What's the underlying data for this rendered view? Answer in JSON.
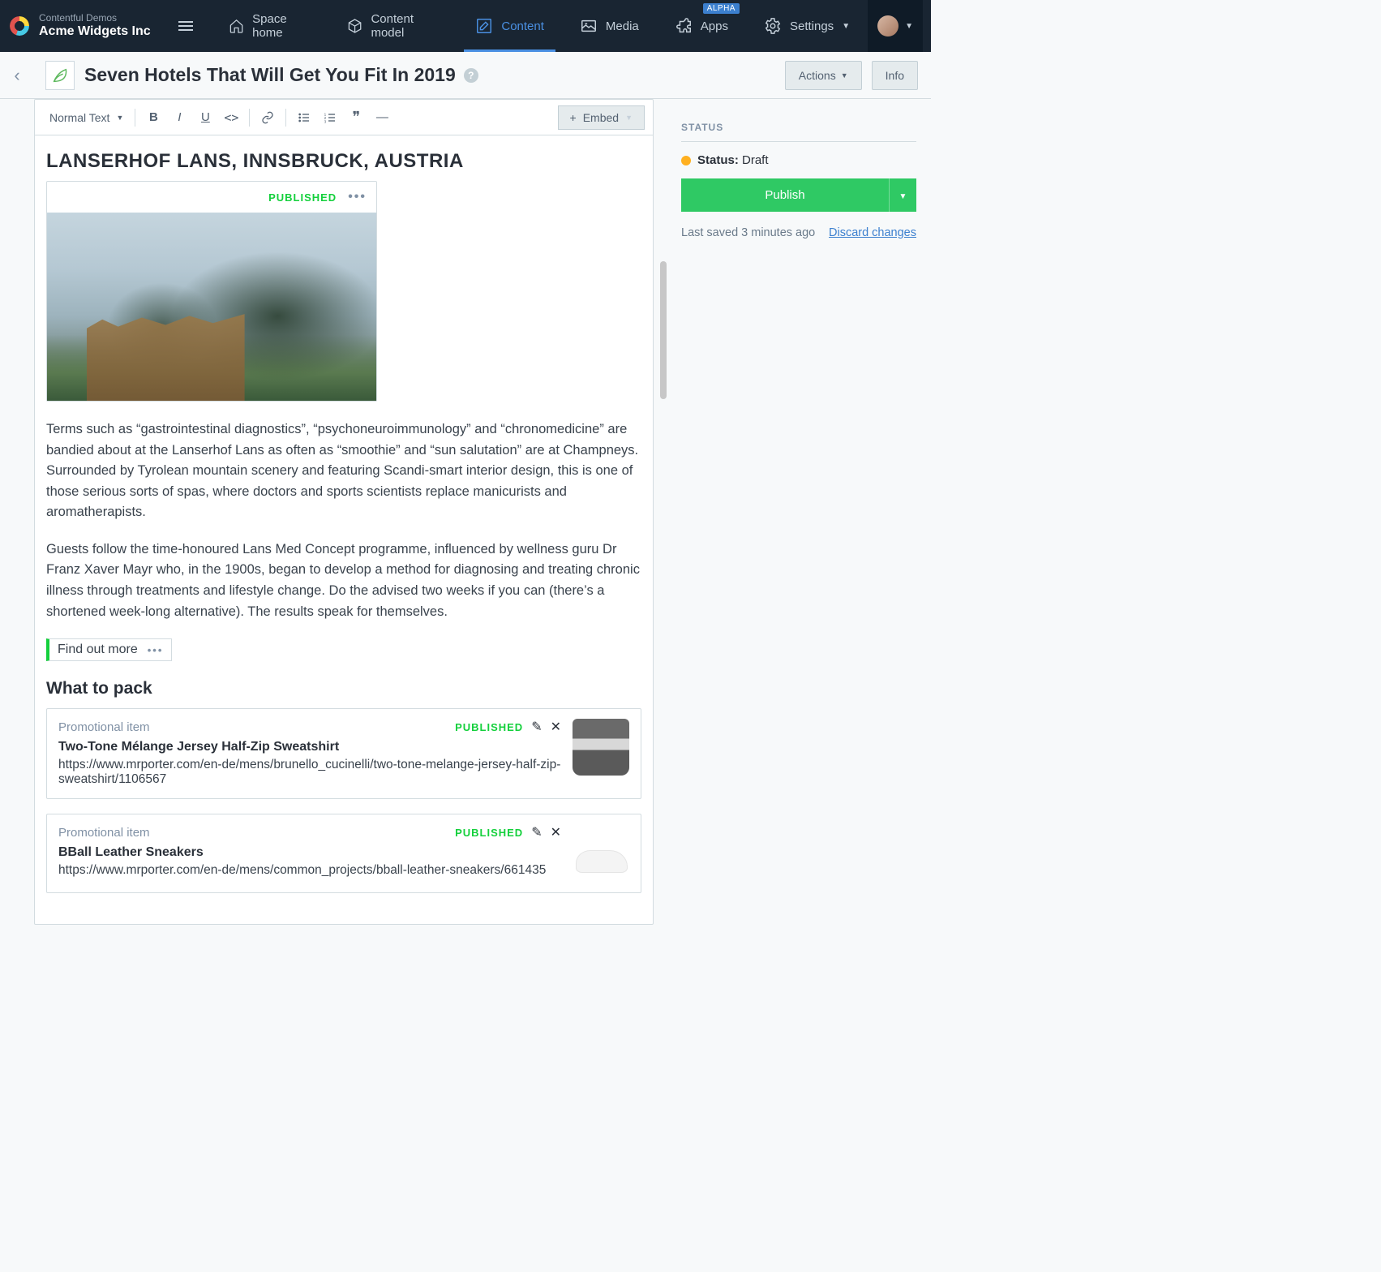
{
  "nav": {
    "org_top": "Contentful Demos",
    "org_bottom": "Acme Widgets Inc",
    "items": [
      {
        "label": "Space home",
        "icon": "home"
      },
      {
        "label": "Content model",
        "icon": "box"
      },
      {
        "label": "Content",
        "icon": "edit",
        "active": true
      },
      {
        "label": "Media",
        "icon": "media"
      },
      {
        "label": "Apps",
        "icon": "puzzle",
        "badge": "ALPHA"
      },
      {
        "label": "Settings",
        "icon": "gear",
        "caret": true
      }
    ]
  },
  "page": {
    "title": "Seven Hotels That Will Get You Fit In 2019",
    "actions_label": "Actions",
    "info_label": "Info"
  },
  "toolbar": {
    "text_style": "Normal Text",
    "embed_label": "Embed"
  },
  "content": {
    "heading": "LANSERHOF LANS, INNSBRUCK, AUSTRIA",
    "image_status": "PUBLISHED",
    "para1": "Terms such as “gastrointestinal diagnostics”, “psychoneuroimmunology” and “chronomedicine” are bandied about at the Lanserhof Lans as often as “smoothie” and “sun salutation” are at Champneys. Surrounded by Tyrolean mountain scenery and featuring Scandi-smart interior design, this is one of those serious sorts of spas, where doctors and sports scientists replace manicurists and aromatherapists.",
    "para2": "Guests follow the time-honoured Lans Med Concept programme, influenced by wellness guru Dr Franz Xaver Mayr who, in the 1900s, began to develop a method for diagnosing and treating chronic illness through treatments and lifestyle change. Do the advised two weeks if you can (there’s a shortened week-long alternative). The results speak for themselves.",
    "inline_entry": "Find out more",
    "subheading": "What to pack",
    "promos": [
      {
        "type": "Promotional item",
        "status": "PUBLISHED",
        "name": "Two-Tone Mélange Jersey Half-Zip Sweatshirt",
        "url": "https://www.mrporter.com/en-de/mens/brunello_cucinelli/two-tone-melange-jersey-half-zip-sweatshirt/1106567",
        "thumb": "sweat"
      },
      {
        "type": "Promotional item",
        "status": "PUBLISHED",
        "name": "BBall Leather Sneakers",
        "url": "https://www.mrporter.com/en-de/mens/common_projects/bball-leather-sneakers/661435",
        "thumb": "shoe"
      }
    ]
  },
  "sidebar": {
    "status_label": "STATUS",
    "status_key": "Status:",
    "status_value": "Draft",
    "publish_label": "Publish",
    "last_saved": "Last saved 3 minutes ago",
    "discard": "Discard changes"
  }
}
